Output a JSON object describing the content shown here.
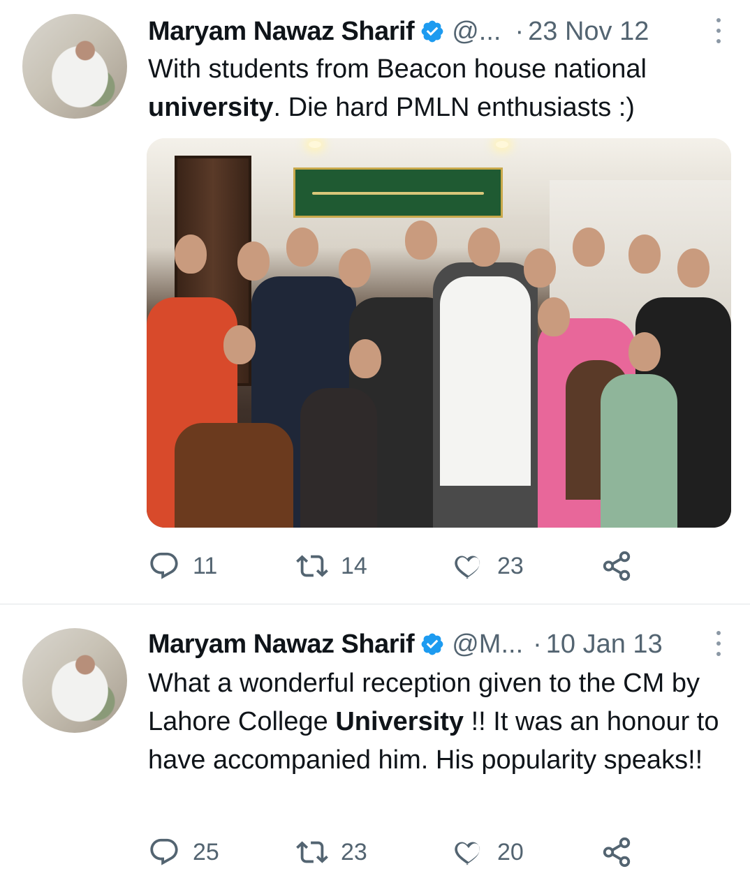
{
  "tweets": [
    {
      "author": "Maryam Nawaz Sharif",
      "handle": "@...",
      "separator": "·",
      "date": "23 Nov 12",
      "text_before_bold": "With students from Beacon house national ",
      "bold": "university",
      "text_after_bold": ". Die hard PMLN enthusiasts :)",
      "replies": "11",
      "retweets": "14",
      "likes": "23"
    },
    {
      "author": "Maryam Nawaz Sharif",
      "handle": "@M...",
      "separator": "·",
      "date": "10 Jan 13",
      "text_before_bold": "What a wonderful reception given to the CM by Lahore College ",
      "bold": "University",
      "text_after_bold": " !! It was an honour to have accompanied him. His popularity speaks!!",
      "replies": "25",
      "retweets": "23",
      "likes": "20"
    }
  ],
  "colors": {
    "verified": "#1d9bf0",
    "muted": "#536471",
    "text": "#0f1419"
  },
  "icons": [
    "reply-icon",
    "retweet-icon",
    "like-icon",
    "share-icon",
    "verified-badge-icon",
    "more-icon"
  ]
}
